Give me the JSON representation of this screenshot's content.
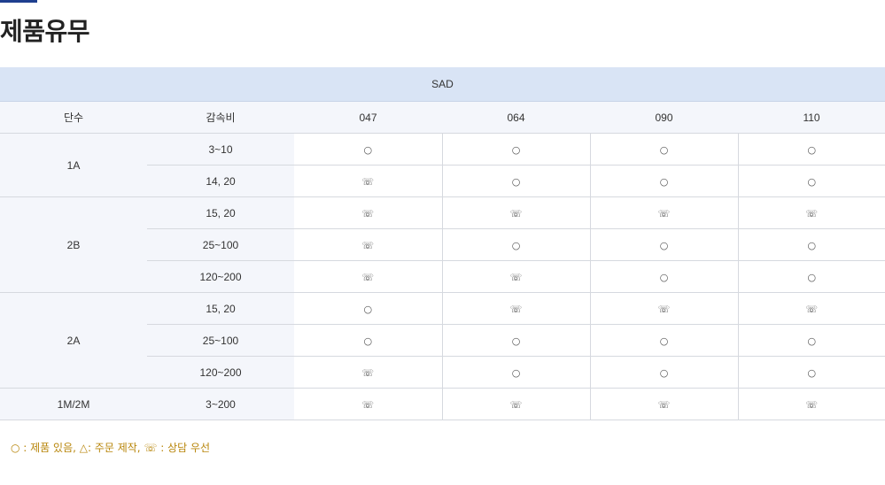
{
  "page": {
    "title": "제품유무"
  },
  "table": {
    "series_label": "SAD",
    "headers": [
      "단수",
      "감속비",
      "047",
      "064",
      "090",
      "110"
    ],
    "groups": [
      {
        "stage": "1A",
        "rows": [
          {
            "ratio": "3~10",
            "cells": [
              "○",
              "○",
              "○",
              "○"
            ]
          },
          {
            "ratio": "14, 20",
            "cells": [
              "☏",
              "○",
              "○",
              "○"
            ]
          }
        ]
      },
      {
        "stage": "2B",
        "rows": [
          {
            "ratio": "15, 20",
            "cells": [
              "☏",
              "☏",
              "☏",
              "☏"
            ]
          },
          {
            "ratio": "25~100",
            "cells": [
              "☏",
              "○",
              "○",
              "○"
            ]
          },
          {
            "ratio": "120~200",
            "cells": [
              "☏",
              "☏",
              "○",
              "○"
            ]
          }
        ]
      },
      {
        "stage": "2A",
        "rows": [
          {
            "ratio": "15, 20",
            "cells": [
              "○",
              "☏",
              "☏",
              "☏"
            ]
          },
          {
            "ratio": "25~100",
            "cells": [
              "○",
              "○",
              "○",
              "○"
            ]
          },
          {
            "ratio": "120~200",
            "cells": [
              "☏",
              "○",
              "○",
              "○"
            ]
          }
        ]
      },
      {
        "stage": "1M/2M",
        "rows": [
          {
            "ratio": "3~200",
            "cells": [
              "☏",
              "☏",
              "☏",
              "☏"
            ]
          }
        ]
      }
    ]
  },
  "legend": {
    "text": "○ : 제품 있음, △: 주문 제작, ☏ : 상담 우선"
  },
  "colors": {
    "accent": "#1f3f8f",
    "header_band": "#d9e4f5",
    "label_band": "#f4f6fb",
    "legend_text": "#b8860b"
  }
}
